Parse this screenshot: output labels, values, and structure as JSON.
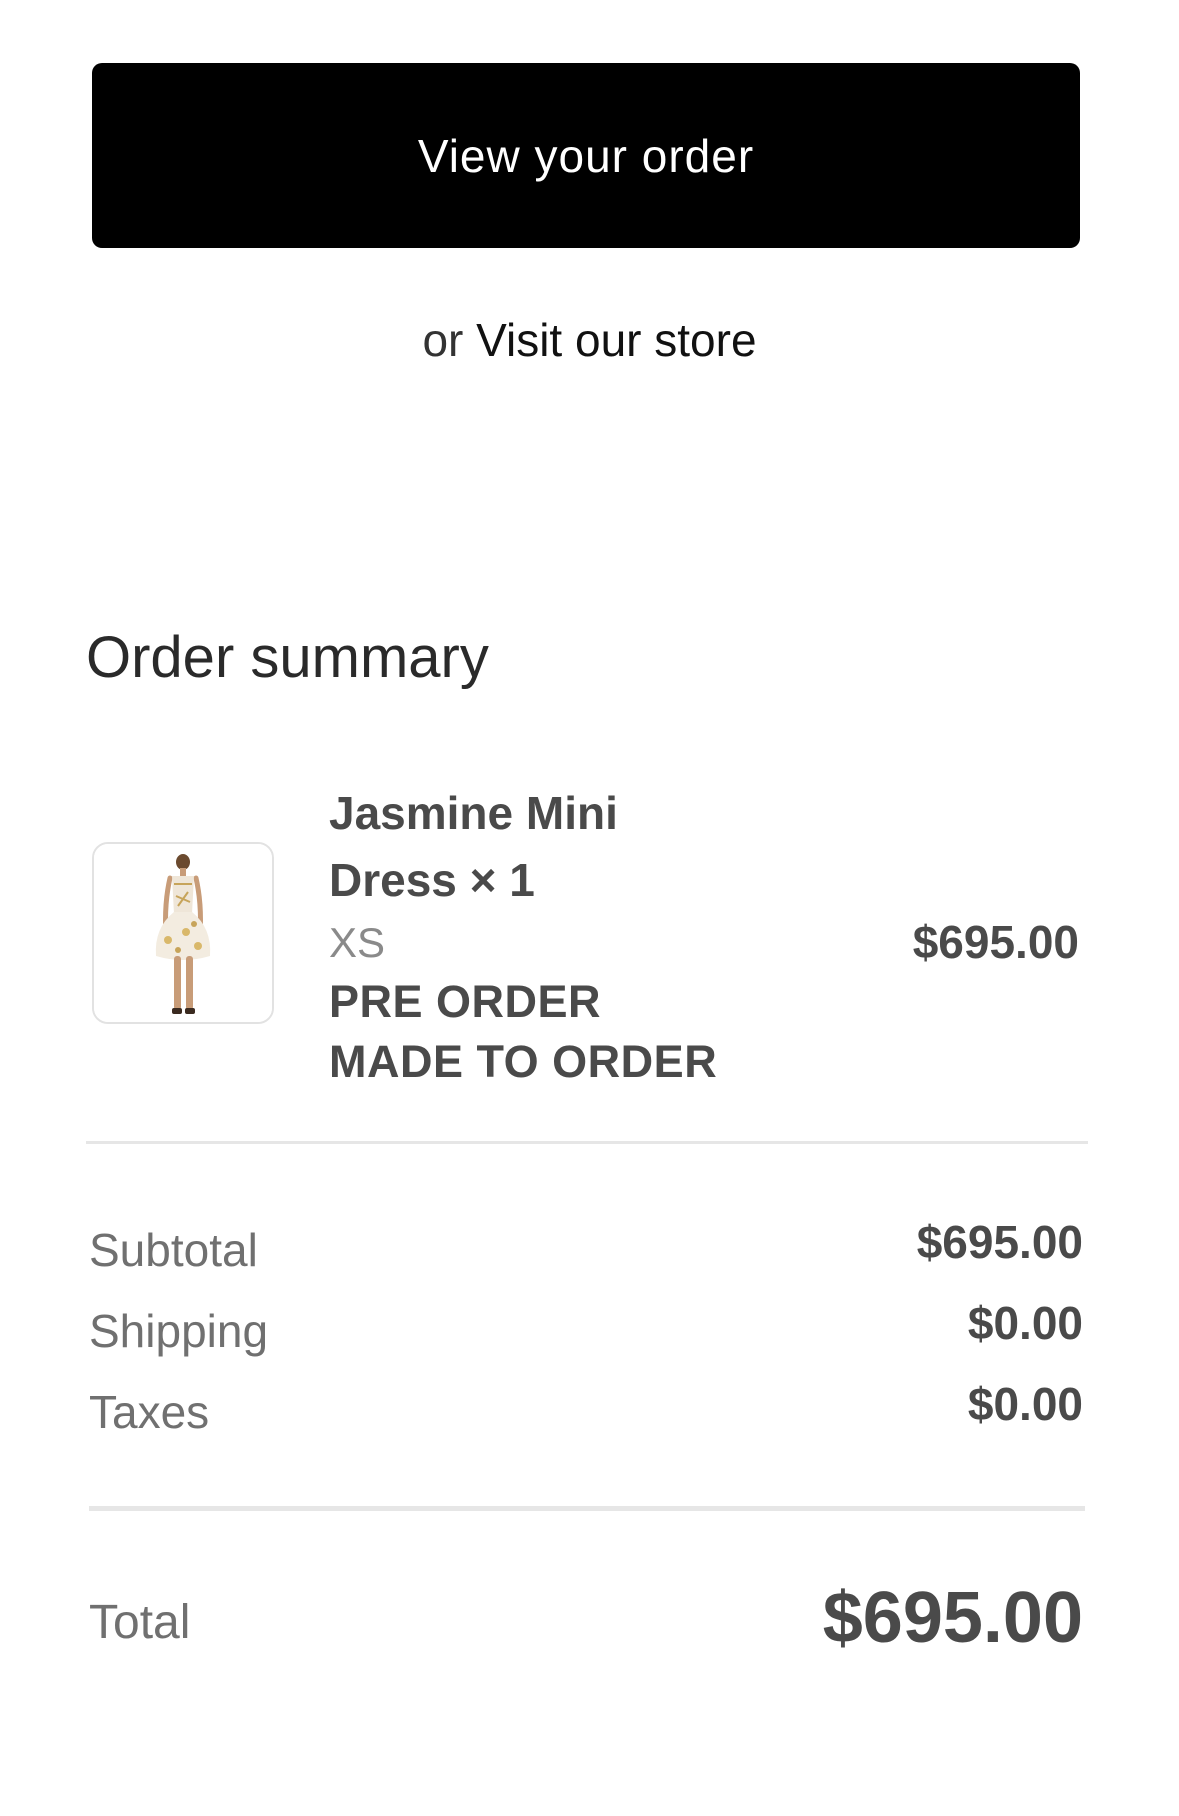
{
  "actions": {
    "view_order_label": "View your order",
    "or_text": "or",
    "visit_store_label": "Visit our store"
  },
  "summary": {
    "title": "Order summary",
    "item": {
      "name_line1": "Jasmine Mini",
      "name_line2": "Dress × 1",
      "variant": "XS",
      "properties": [
        "PRE ORDER",
        "MADE TO ORDER"
      ],
      "price": "$695.00",
      "image_icon": "dress-product-image"
    },
    "costs": [
      {
        "label": "Subtotal",
        "value": "$695.00"
      },
      {
        "label": "Shipping",
        "value": "$0.00"
      },
      {
        "label": "Taxes",
        "value": "$0.00"
      }
    ],
    "total": {
      "label": "Total",
      "value": "$695.00"
    }
  }
}
